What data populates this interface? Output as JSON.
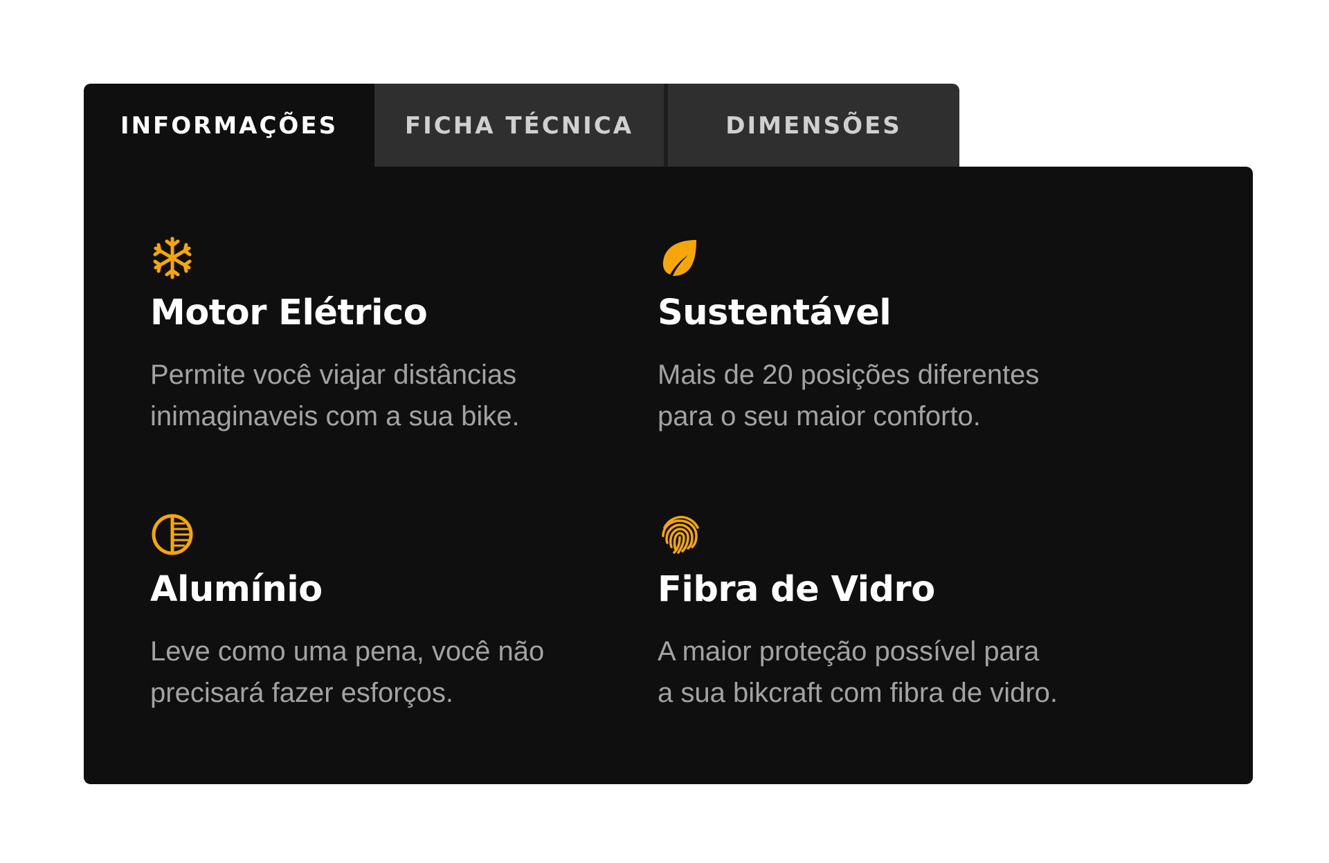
{
  "tabs": [
    {
      "label": "INFORMAÇÕES",
      "active": true
    },
    {
      "label": "FICHA TÉCNICA",
      "active": false
    },
    {
      "label": "DIMENSÕES",
      "active": false
    }
  ],
  "accent_color": "#f5a70a",
  "features": [
    {
      "icon": "snowflake-icon",
      "title": "Motor Elétrico",
      "desc_line1": "Permite você viajar distâncias",
      "desc_line2": "inimaginaveis com a sua bike."
    },
    {
      "icon": "leaf-icon",
      "title": "Sustentável",
      "desc_line1": "Mais de 20 posições diferentes",
      "desc_line2": "para o seu maior conforto."
    },
    {
      "icon": "contrast-icon",
      "title": "Alumínio",
      "desc_line1": "Leve como uma pena, você não",
      "desc_line2": "precisará fazer esforços."
    },
    {
      "icon": "fingerprint-icon",
      "title": "Fibra de Vidro",
      "desc_line1": "A maior proteção possível para",
      "desc_line2": "a sua bikcraft com fibra de vidro."
    }
  ]
}
